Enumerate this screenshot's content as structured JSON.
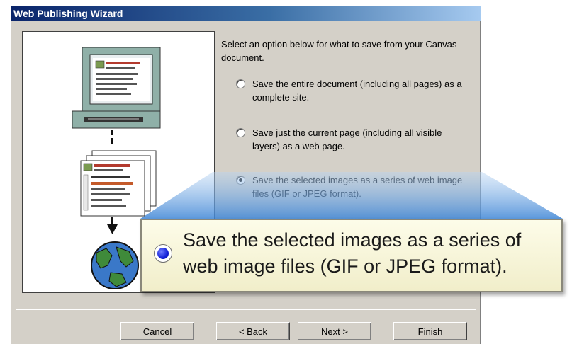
{
  "window": {
    "title": "Web Publishing Wizard"
  },
  "intro_text": "Select an option below for what to save from your Canvas document.",
  "options": [
    {
      "label": "Save the entire document (including all pages) as a complete site.",
      "selected": false
    },
    {
      "label": "Save just the current page (including all visible layers) as a web page.",
      "selected": false
    },
    {
      "label": "Save the selected images as a series of web image files (GIF or JPEG format).",
      "selected": true
    }
  ],
  "buttons": {
    "cancel": "Cancel",
    "back": "< Back",
    "next": "Next >",
    "finish": "Finish"
  },
  "callout": {
    "text": "Save the selected images as a series of web image files (GIF or JPEG format).",
    "selected": true
  },
  "illustration": {
    "icons": [
      "monitor-icon",
      "web-pages-icon",
      "arrow-down-icon",
      "globe-icon"
    ]
  },
  "colors": {
    "title_bar_start": "#0a246a",
    "title_bar_end": "#a6caf0",
    "dialog_face": "#d4d0c8",
    "callout_background": "#f6f4d8",
    "callout_radio_fill": "#1a26e0"
  }
}
